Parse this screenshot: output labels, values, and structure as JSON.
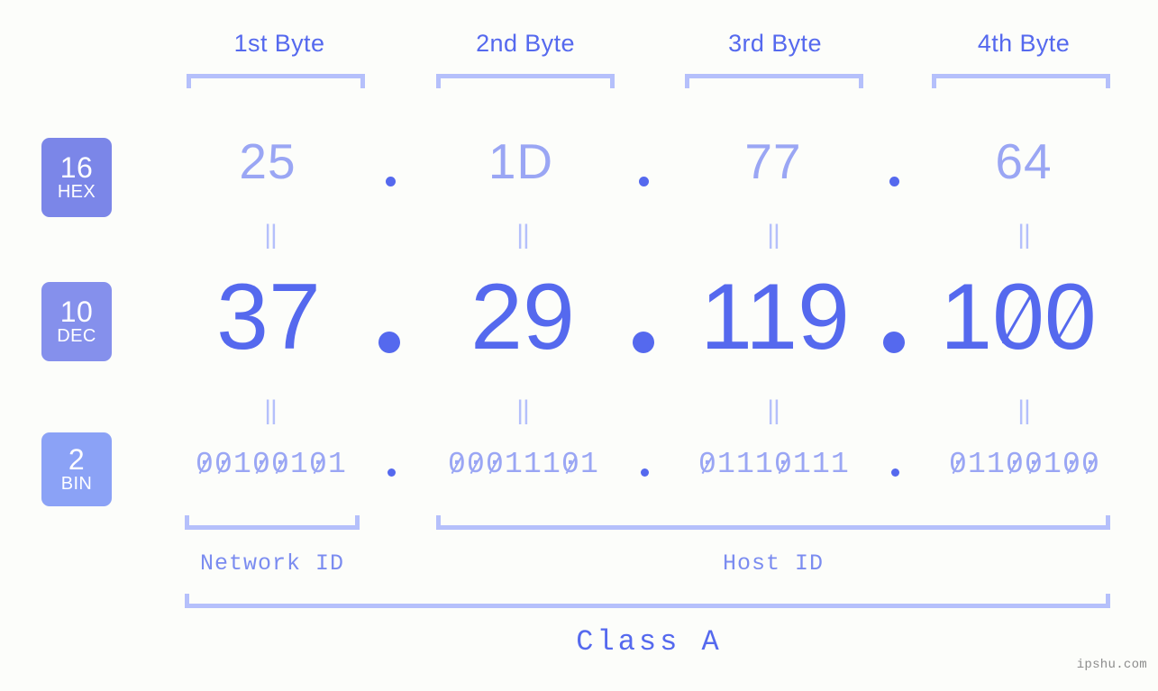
{
  "background_color": "#fcfdfa",
  "accent_colors": {
    "strong_blue": "#5569ee",
    "light_blue": "#9aa6f4",
    "bracket_blue": "#b5c0fb",
    "badge_hex": "#7b86e8",
    "badge_dec": "#8590ec",
    "badge_bin": "#8ba2f6"
  },
  "byte_headers": [
    {
      "label": "1st Byte"
    },
    {
      "label": "2nd Byte"
    },
    {
      "label": "3rd Byte"
    },
    {
      "label": "4th Byte"
    }
  ],
  "radix_badges": [
    {
      "number": "16",
      "name": "HEX"
    },
    {
      "number": "10",
      "name": "DEC"
    },
    {
      "number": "2",
      "name": "BIN"
    }
  ],
  "rows": {
    "hex": {
      "radix": "16",
      "radix_name": "HEX",
      "values": [
        "25",
        "1D",
        "77",
        "64"
      ],
      "separator": "."
    },
    "dec": {
      "radix": "10",
      "radix_name": "DEC",
      "values": [
        "37",
        "29",
        "119",
        "100"
      ],
      "separator": "."
    },
    "bin": {
      "radix": "2",
      "radix_name": "BIN",
      "values": [
        "00100101",
        "00011101",
        "01110111",
        "01100100"
      ],
      "separator": "."
    }
  },
  "equals_marker": "||",
  "segments": {
    "network_id": "Network ID",
    "host_id": "Host ID"
  },
  "class_label": "Class A",
  "watermark": "ipshu.com",
  "ip_address": {
    "hex": "25.1D.77.64",
    "decimal": "37.29.119.100",
    "binary": "00100101.00011101.01110111.01100100"
  }
}
